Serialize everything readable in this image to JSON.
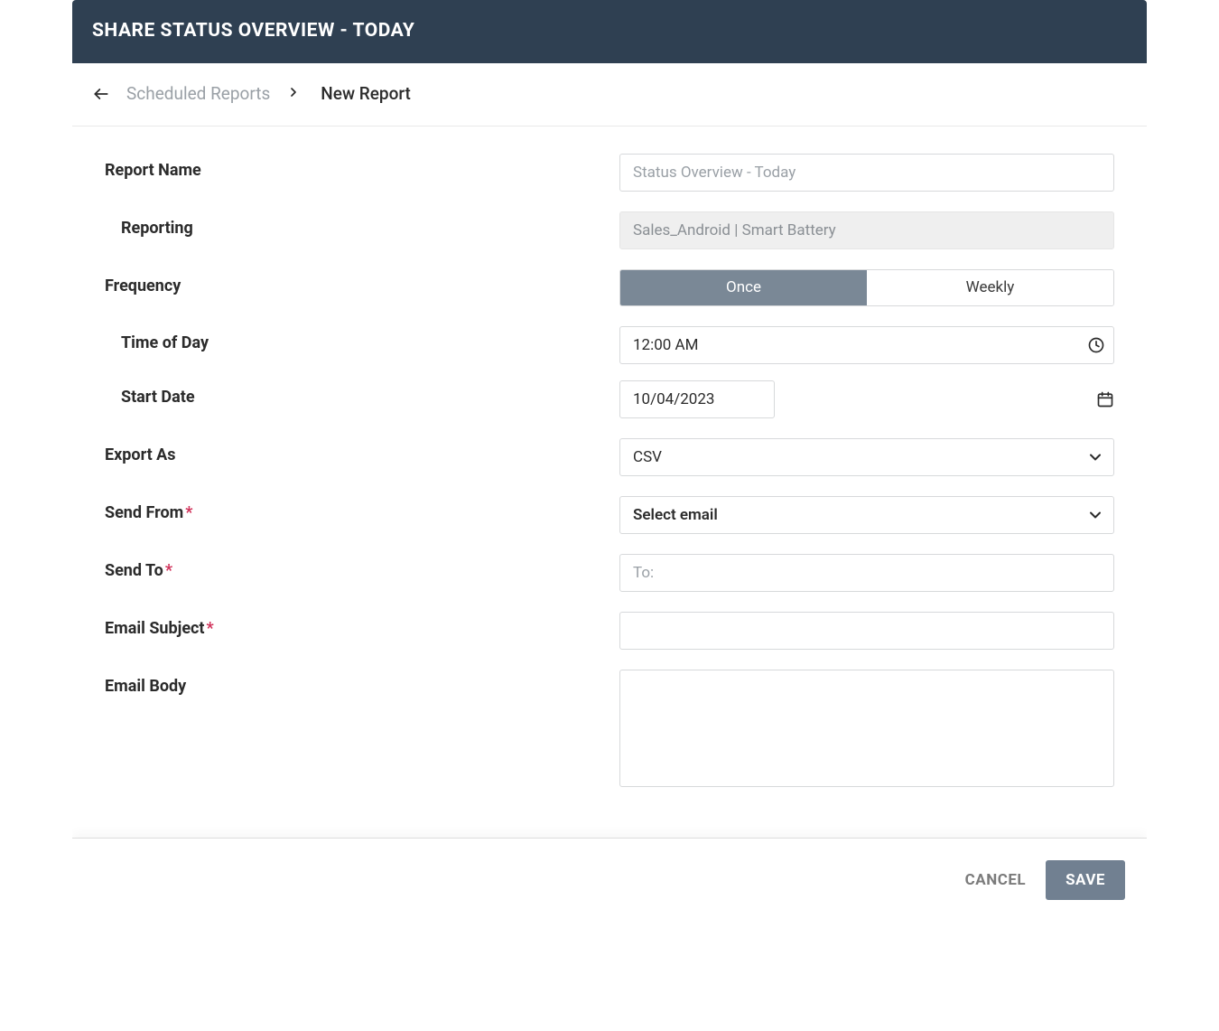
{
  "header": {
    "title": "SHARE STATUS OVERVIEW - TODAY"
  },
  "breadcrumb": {
    "parent": "Scheduled Reports",
    "current": "New Report"
  },
  "form": {
    "report_name": {
      "label": "Report Name",
      "placeholder": "Status Overview - Today",
      "value": ""
    },
    "reporting": {
      "label": "Reporting",
      "value": "Sales_Android | Smart Battery"
    },
    "frequency": {
      "label": "Frequency",
      "options": [
        "Once",
        "Weekly"
      ],
      "selected": "Once"
    },
    "time_of_day": {
      "label": "Time of Day",
      "value": "12:00 AM"
    },
    "start_date": {
      "label": "Start Date",
      "value": "10/04/2023"
    },
    "export_as": {
      "label": "Export As",
      "value": "CSV"
    },
    "send_from": {
      "label": "Send From",
      "required": true,
      "value": "Select email"
    },
    "send_to": {
      "label": "Send To",
      "required": true,
      "prefix": "To:"
    },
    "email_subject": {
      "label": "Email Subject",
      "required": true,
      "value": ""
    },
    "email_body": {
      "label": "Email Body",
      "value": ""
    }
  },
  "footer": {
    "cancel": "CANCEL",
    "save": "SAVE"
  }
}
